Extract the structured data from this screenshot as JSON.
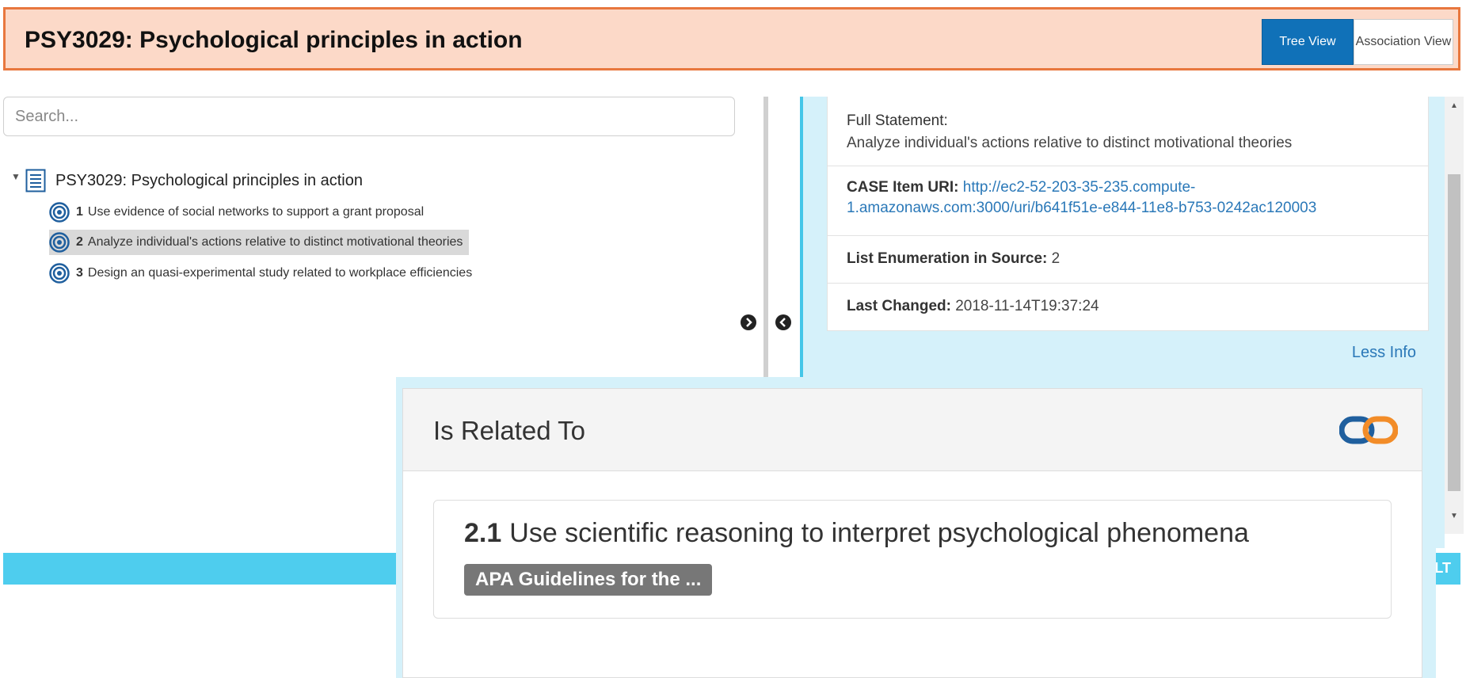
{
  "header": {
    "title": "PSY3029: Psychological principles in action",
    "tree_view_label": "Tree View",
    "association_view_label": "Association View"
  },
  "search": {
    "placeholder": "Search..."
  },
  "tree": {
    "root_label": "PSY3029: Psychological principles in action",
    "items": [
      {
        "number": "1",
        "text": "Use evidence of social networks to support a grant proposal",
        "selected": false
      },
      {
        "number": "2",
        "text": "Analyze individual's actions relative to distinct motivational theories",
        "selected": true
      },
      {
        "number": "3",
        "text": "Design an quasi-experimental study related to workplace efficiencies",
        "selected": false
      }
    ]
  },
  "details": {
    "full_statement_label": "Full Statement:",
    "full_statement_value": "Analyze individual's actions relative to distinct motivational theories",
    "uri_label": "CASE Item URI:",
    "uri_line1": "http://ec2-52-203-35-235.compute-",
    "uri_line2": "1.amazonaws.com:3000/uri/b641f51e-e844-11e8-b753-0242ac120003",
    "enumeration_label": "List Enumeration in Source:",
    "enumeration_value": "2",
    "last_changed_label": "Last Changed:",
    "last_changed_value": "2018-11-14T19:37:24",
    "less_info": "Less Info"
  },
  "bottom_bar": {
    "peek_text": "LT"
  },
  "popup": {
    "title": "Is Related To",
    "related_number": "2.1",
    "related_text": "Use scientific reasoning to interpret psychological phenomena",
    "badge": "APA Guidelines for the ..."
  },
  "colors": {
    "header_bg": "#fcd9c8",
    "header_border": "#e8773e",
    "primary_blue": "#1071b8",
    "panel_cyan": "#d5f1fa",
    "bar_cyan": "#4ecdee",
    "link_blue": "#2a78b8",
    "chain_blue": "#1f5f9e",
    "chain_orange": "#f28c28"
  },
  "icons": {
    "tree_caret": "caret-down-icon",
    "root": "document-list-icon",
    "item": "target-icon",
    "expand": "chevron-right-circle-icon",
    "collapse": "chevron-left-circle-icon",
    "association": "chain-link-icon"
  }
}
